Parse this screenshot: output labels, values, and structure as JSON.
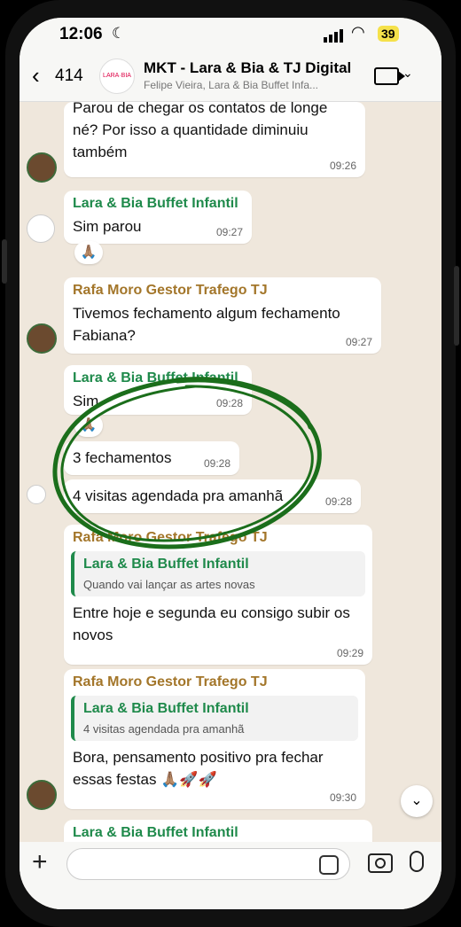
{
  "status": {
    "time": "12:06",
    "battery": "39"
  },
  "header": {
    "back_count": "414",
    "title": "MKT - Lara & Bia & TJ Digital",
    "subtitle": "Felipe Vieira, Lara & Bia Buffet Infa..."
  },
  "messages": {
    "m1": {
      "text": "Parou de chegar os contatos de longe né? Por isso a quantidade diminuiu também",
      "time": "09:26"
    },
    "m2": {
      "sender": "Lara & Bia Buffet Infantil",
      "text": "Sim parou",
      "time": "09:27",
      "reaction": "🙏🏽"
    },
    "m3": {
      "sender": "Rafa Moro Gestor Trafego TJ",
      "text": "Tivemos fechamento algum fechamento Fabiana?",
      "time": "09:27"
    },
    "m4": {
      "sender": "Lara & Bia Buffet Infantil",
      "text": "Sim",
      "time": "09:28",
      "reaction": "🙏🏽"
    },
    "m5": {
      "text": "3 fechamentos",
      "time": "09:28"
    },
    "m6": {
      "text": "4 visitas agendada pra amanhã",
      "time": "09:28"
    },
    "m7": {
      "sender": "Rafa Moro Gestor Trafego TJ",
      "quote_sender": "Lara & Bia Buffet Infantil",
      "quote_text": "Quando vai lançar as artes novas",
      "text": "Entre hoje e segunda eu consigo subir os novos",
      "time": "09:29"
    },
    "m8": {
      "sender": "Rafa Moro Gestor Trafego TJ",
      "quote_sender": "Lara & Bia Buffet Infantil",
      "quote_text": "4 visitas agendada pra amanhã",
      "text": "Bora, pensamento positivo pra fechar essas festas 🙏🏽🚀🚀",
      "time": "09:30"
    },
    "m9": {
      "sender": "Lara & Bia Buffet Infantil"
    }
  },
  "colors": {
    "lara_sender": "#1f8a4b",
    "rafa_sender": "#a3762a",
    "annotation": "#1b6e1b"
  },
  "icons": [
    "back-chevron-icon",
    "video-call-icon",
    "plus-icon",
    "sticker-icon",
    "camera-icon",
    "mic-icon",
    "scroll-down-icon"
  ]
}
